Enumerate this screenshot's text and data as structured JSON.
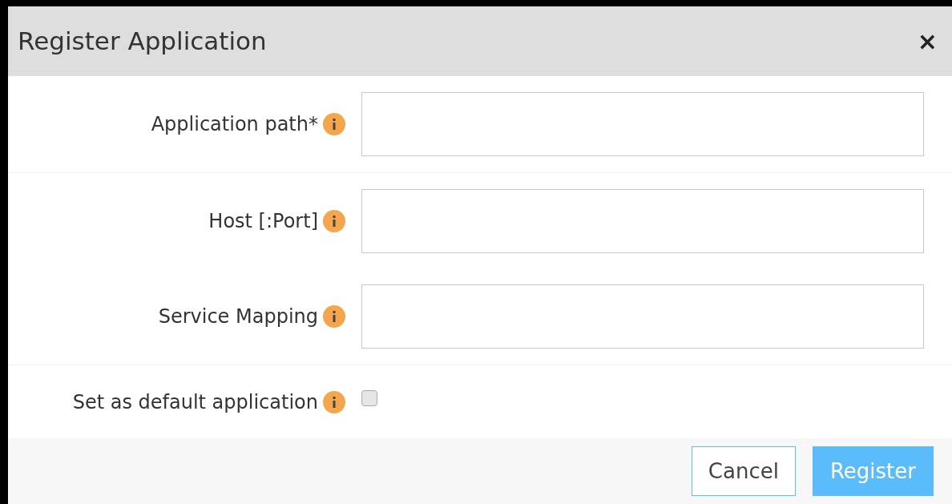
{
  "dialog": {
    "title": "Register Application",
    "close": "×"
  },
  "fields": [
    {
      "kind": "text",
      "label": "Application path*"
    },
    {
      "kind": "text",
      "label": "Host [:Port]"
    },
    {
      "kind": "text",
      "label": "Service Mapping"
    },
    {
      "kind": "checkbox",
      "label": "Set as default application",
      "checked": false
    }
  ],
  "buttons": [
    {
      "label": "Cancel",
      "primary": false
    },
    {
      "label": "Register",
      "primary": true
    }
  ]
}
